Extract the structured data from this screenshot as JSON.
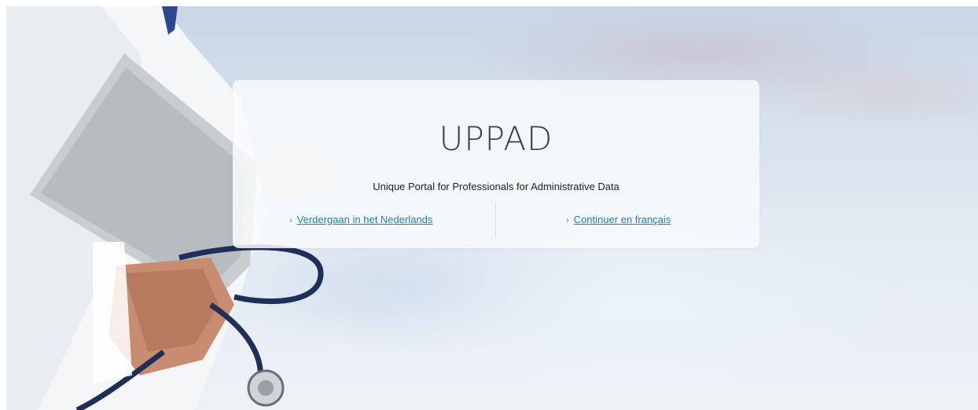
{
  "portal": {
    "title": "UPPAD",
    "subtitle": "Unique Portal for Professionals for Administrative Data"
  },
  "languages": [
    {
      "label": "Verdergaan in het Nederlands",
      "chevron": "›"
    },
    {
      "label": "Continuer en français",
      "chevron": "›"
    }
  ],
  "icons": {
    "hero": "doctor-with-tablet-and-stethoscope-image",
    "link_chevron": "chevron-right-icon"
  },
  "colors": {
    "link": "#1a84a8",
    "title": "#3b3f45",
    "card_background": "#f8fafc"
  }
}
